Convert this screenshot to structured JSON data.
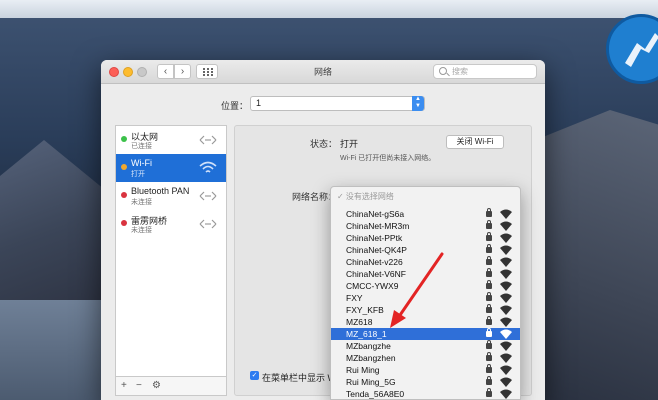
{
  "window": {
    "title": "网络",
    "search_placeholder": "搜索"
  },
  "location": {
    "label": "位置：",
    "value": "1"
  },
  "sidebar": {
    "items": [
      {
        "name": "以太网",
        "status": "已连接",
        "dot_color": "#3cc14a"
      },
      {
        "name": "Wi-Fi",
        "status": "打开",
        "dot_color": "#f0a830"
      },
      {
        "name": "Bluetooth PAN",
        "status": "未连接",
        "dot_color": "#d9333f"
      },
      {
        "name": "雷雳网桥",
        "status": "未连接",
        "dot_color": "#d9333f"
      }
    ],
    "footer": {
      "add": "+",
      "remove": "−",
      "actions": "⚙"
    }
  },
  "panel": {
    "status_label": "状态：",
    "status_value": "打开",
    "turn_off_button": "关闭 Wi-Fi",
    "description": "Wi-Fi 已打开但尚未接入网络。",
    "network_name_label": "网络名称：",
    "show_in_menubar_label": "在菜单栏中显示 W"
  },
  "dropdown": {
    "header": "✓ 没有选择网络",
    "networks": [
      "ChinaNet-gS6a",
      "ChinaNet-MR3m",
      "ChinaNet-PPtk",
      "ChinaNet-QK4P",
      "ChinaNet-v226",
      "ChinaNet-V6NF",
      "CMCC-YWX9",
      "FXY",
      "FXY_KFB",
      "MZ618",
      "MZ_618_1",
      "MZbangzhe",
      "MZbangzhen",
      "Rui Ming",
      "Rui Ming_5G",
      "Tenda_56A8E0"
    ],
    "highlighted": "MZ_618_1"
  },
  "colors": {
    "selection": "#1f6fd7",
    "annotation_arrow": "#e32424"
  }
}
